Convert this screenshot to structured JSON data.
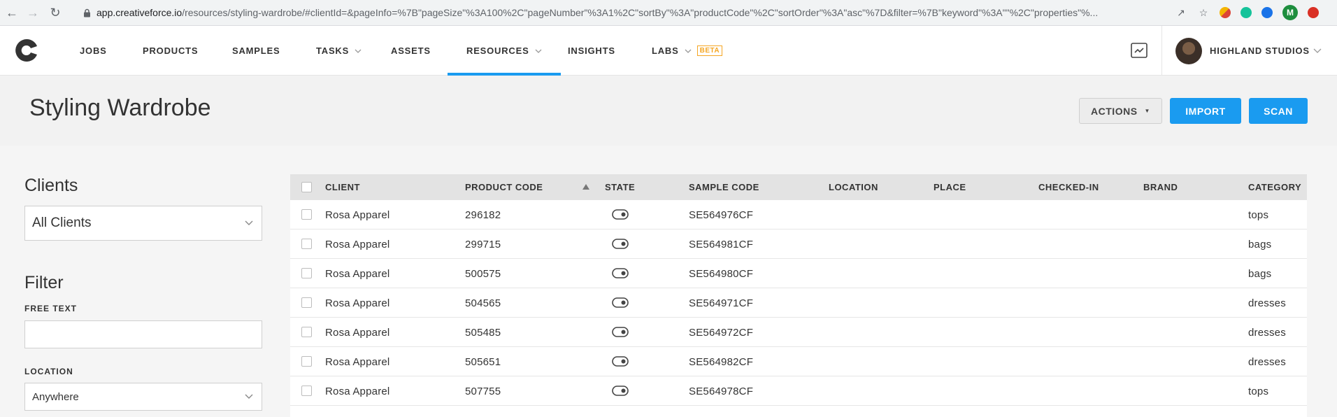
{
  "browser": {
    "url_host": "app.creativeforce.io",
    "url_path": "/resources/styling-wardrobe/#clientId=&pageInfo=%7B\"pageSize\"%3A100%2C\"pageNumber\"%3A1%2C\"sortBy\"%3A\"productCode\"%2C\"sortOrder\"%3A\"asc\"%7D&filter=%7B\"keyword\"%3A\"\"%2C\"properties\"%...",
    "profile_initial": "M"
  },
  "nav": {
    "items": [
      {
        "label": "JOBS"
      },
      {
        "label": "PRODUCTS"
      },
      {
        "label": "SAMPLES"
      },
      {
        "label": "TASKS"
      },
      {
        "label": "ASSETS"
      },
      {
        "label": "RESOURCES"
      },
      {
        "label": "INSIGHTS"
      },
      {
        "label": "LABS"
      }
    ],
    "beta_label": "BETA",
    "studio_name": "HIGHLAND STUDIOS",
    "accent_color": "#1a9bf0"
  },
  "page": {
    "title": "Styling Wardrobe",
    "actions_label": "ACTIONS",
    "import_label": "IMPORT",
    "scan_label": "SCAN"
  },
  "sidebar": {
    "clients_heading": "Clients",
    "clients_value": "All Clients",
    "filter_heading": "Filter",
    "free_text_label": "FREE TEXT",
    "free_text_value": "",
    "location_label": "LOCATION",
    "location_value": "Anywhere"
  },
  "table": {
    "columns": [
      "CLIENT",
      "PRODUCT CODE",
      "STATE",
      "SAMPLE CODE",
      "LOCATION",
      "PLACE",
      "CHECKED-IN",
      "BRAND",
      "CATEGORY"
    ],
    "sorted_column": "PRODUCT CODE",
    "sort_direction": "asc",
    "rows": [
      {
        "client": "Rosa Apparel",
        "product_code": "296182",
        "sample_code": "SE564976CF",
        "location": "",
        "place": "",
        "checked_in": "",
        "brand": "",
        "category": "tops"
      },
      {
        "client": "Rosa Apparel",
        "product_code": "299715",
        "sample_code": "SE564981CF",
        "location": "",
        "place": "",
        "checked_in": "",
        "brand": "",
        "category": "bags"
      },
      {
        "client": "Rosa Apparel",
        "product_code": "500575",
        "sample_code": "SE564980CF",
        "location": "",
        "place": "",
        "checked_in": "",
        "brand": "",
        "category": "bags"
      },
      {
        "client": "Rosa Apparel",
        "product_code": "504565",
        "sample_code": "SE564971CF",
        "location": "",
        "place": "",
        "checked_in": "",
        "brand": "",
        "category": "dresses"
      },
      {
        "client": "Rosa Apparel",
        "product_code": "505485",
        "sample_code": "SE564972CF",
        "location": "",
        "place": "",
        "checked_in": "",
        "brand": "",
        "category": "dresses"
      },
      {
        "client": "Rosa Apparel",
        "product_code": "505651",
        "sample_code": "SE564982CF",
        "location": "",
        "place": "",
        "checked_in": "",
        "brand": "",
        "category": "dresses"
      },
      {
        "client": "Rosa Apparel",
        "product_code": "507755",
        "sample_code": "SE564978CF",
        "location": "",
        "place": "",
        "checked_in": "",
        "brand": "",
        "category": "tops"
      }
    ]
  }
}
